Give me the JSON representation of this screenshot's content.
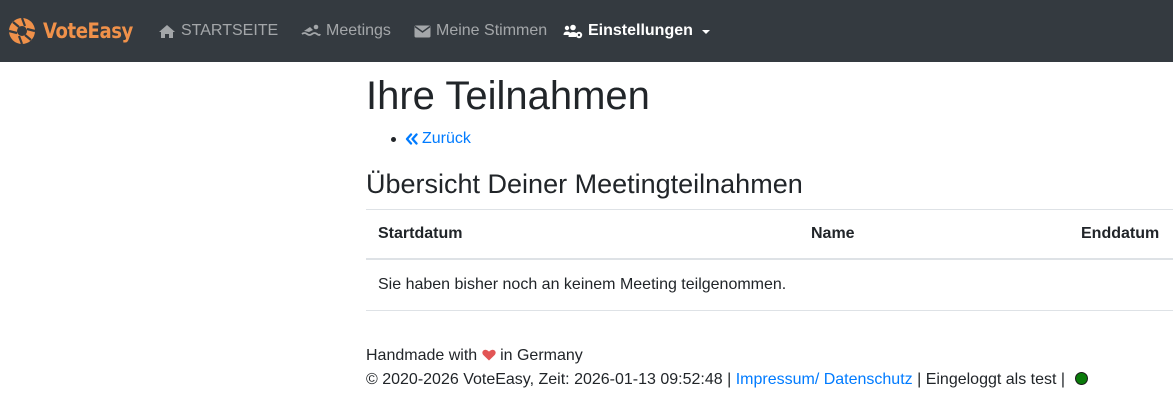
{
  "brand": {
    "name": "VoteEasy",
    "color": "#f0914a"
  },
  "nav": {
    "items": [
      {
        "label": "STARTSEITE",
        "icon": "home-icon"
      },
      {
        "label": "Meetings",
        "icon": "swimmer-icon"
      },
      {
        "label": "Meine Stimmen",
        "icon": "envelope-icon"
      },
      {
        "label": "Einstellungen",
        "icon": "users-cog-icon",
        "active": true,
        "dropdown": true
      }
    ]
  },
  "page": {
    "title": "Ihre Teilnahmen",
    "back_link": "Zurück",
    "section_title": "Übersicht Deiner Meetingteilnahmen"
  },
  "table": {
    "headers": [
      "Startdatum",
      "Name",
      "Enddatum"
    ],
    "empty_message": "Sie haben bisher noch an keinem Meeting teilgenommen."
  },
  "footer": {
    "handmade_prefix": "Handmade with",
    "handmade_suffix": "in Germany",
    "copyright": "© 2020-2026 VoteEasy, Zeit: 2026-01-13 09:52:48 |",
    "impressum_link": "Impressum/ Datenschutz",
    "logged_in": "| Eingeloggt als test |",
    "status_color": "#0a7a0a"
  }
}
